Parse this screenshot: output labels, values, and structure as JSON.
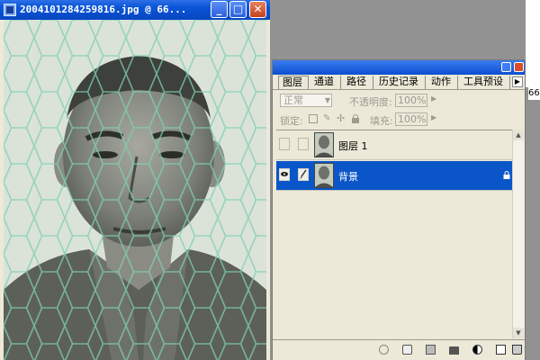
{
  "document": {
    "title": "2004101284259816.jpg @ 66...",
    "min_label": "_",
    "max_label": "□",
    "close_label": "✕",
    "photo_tint": "#d4ddd0",
    "mesh_color": "#7fcfb0"
  },
  "workspace": {
    "background": "#929292",
    "edge_label": "66"
  },
  "palette": {
    "tabs": [
      {
        "label": "图层",
        "active": true
      },
      {
        "label": "通道",
        "active": false
      },
      {
        "label": "路径",
        "active": false
      },
      {
        "label": "历史记录",
        "active": false
      },
      {
        "label": "动作",
        "active": false
      },
      {
        "label": "工具预设",
        "active": false
      }
    ],
    "menu_arrow": "▶",
    "blend_mode": "正常",
    "opacity_label": "不透明度:",
    "opacity_value": "100%",
    "lock_label": "锁定:",
    "fill_label": "填充:",
    "fill_value": "100%",
    "layers": [
      {
        "name": "图层 1",
        "selected": false,
        "visible": false
      },
      {
        "name": "背景",
        "selected": true,
        "visible": true
      }
    ],
    "selection_color": "#0a56c8",
    "scroll_up": "▲",
    "scroll_down": "▼"
  }
}
